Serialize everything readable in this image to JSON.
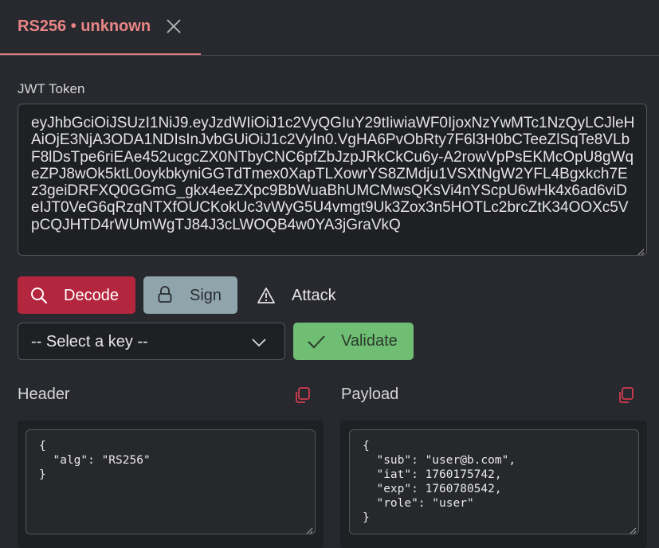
{
  "tab": {
    "title": "RS256 • unknown",
    "close_icon": "close-icon"
  },
  "token": {
    "label": "JWT Token",
    "value": "eyJhbGciOiJSUzI1NiJ9.eyJzdWIiOiJ1c2VyQGIuY29tIiwiaWF0IjoxNzYwMTc1NzQyLCJleHAiOjE3NjA3ODA1NDIsInJvbGUiOiJ1c2VyIn0.VgHA6PvObRty7F6l3H0bCTeeZlSqTe8VLbF8lDsTpe6riEAe452ucgcZX0NTbyCNC6pfZbJzpJRkCkCu6y-A2rowVpPsEKMcOpU8gWqeZPJ8wOk5ktL0oykbkyniGGTdTmex0XapTLXowrYS8ZMdju1VSXtNgW2YFL4Bgxkch7Ez3geiDRFXQ0GGmG_gkx4eeZXpc9BbWuaBhUMCMwsQKsVi4nYScpU6wHk4x6ad6viDeIJT0VeG6qRzqNTXfOUCKokUc3vWyG5U4vmgt9Uk3Zox3n5HOTLc2brcZtK34OOXc5VpCQJHTD4rWUmWgTJ84J3cLWOQB4w0YA3jGraVkQ"
  },
  "actions": {
    "decode": "Decode",
    "sign": "Sign",
    "attack": "Attack"
  },
  "key_select": {
    "selected": "-- Select a key --"
  },
  "validate": {
    "label": "Validate"
  },
  "header_panel": {
    "title": "Header",
    "lines": [
      "{",
      "  \"alg\": \"RS256\"",
      "}"
    ]
  },
  "payload_panel": {
    "title": "Payload",
    "lines": [
      "{",
      "  \"sub\": \"user@b.com\",",
      "  \"iat\": 1760175742,",
      "  \"exp\": 1760780542,",
      "  \"role\": \"user\"",
      "}"
    ]
  },
  "colors": {
    "accent": "#e88585",
    "decode": "#b4253e",
    "sign": "#8fa4ab",
    "validate": "#6fbe73",
    "copy": "#d23b4f"
  }
}
